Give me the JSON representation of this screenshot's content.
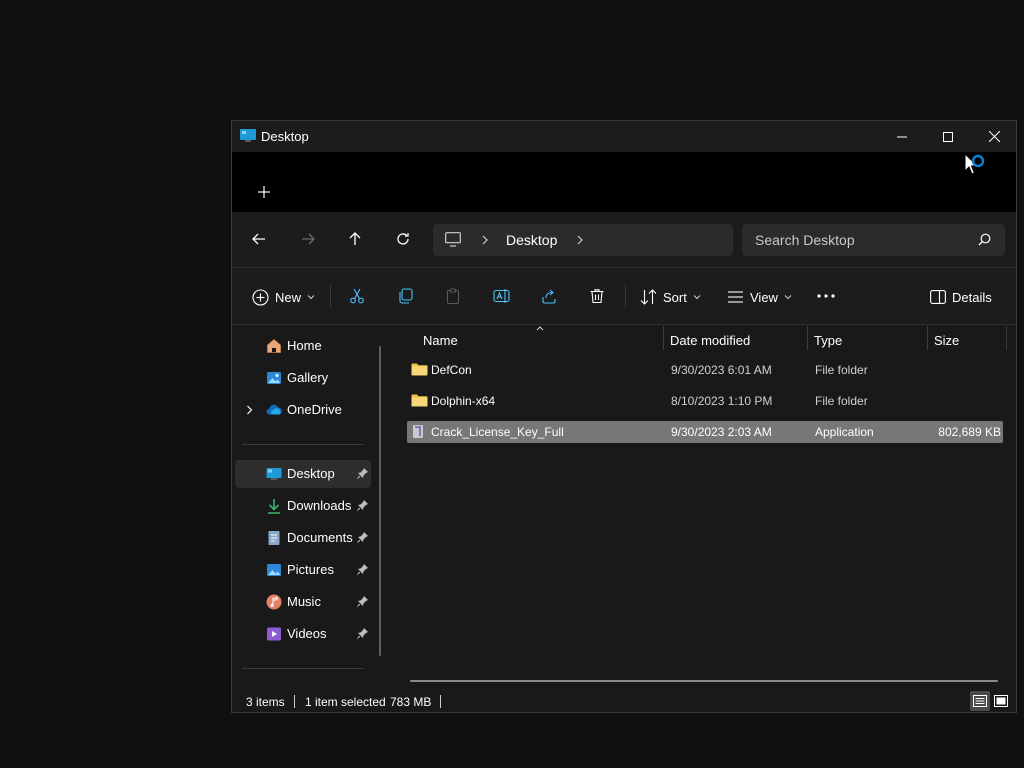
{
  "window": {
    "title": "Desktop"
  },
  "navbar": {
    "address_segment": "Desktop",
    "search_placeholder": "Search Desktop"
  },
  "commands": {
    "new_label": "New",
    "sort_label": "Sort",
    "view_label": "View",
    "details_label": "Details"
  },
  "sidebar": {
    "items": [
      {
        "label": "Home",
        "icon": "home-icon"
      },
      {
        "label": "Gallery",
        "icon": "gallery-icon"
      },
      {
        "label": "OneDrive",
        "icon": "onedrive-icon"
      },
      {
        "label": "Desktop",
        "icon": "desktop-icon",
        "pinned": true,
        "active": true
      },
      {
        "label": "Downloads",
        "icon": "download-icon",
        "pinned": true
      },
      {
        "label": "Documents",
        "icon": "document-icon",
        "pinned": true
      },
      {
        "label": "Pictures",
        "icon": "pictures-icon",
        "pinned": true
      },
      {
        "label": "Music",
        "icon": "music-icon",
        "pinned": true
      },
      {
        "label": "Videos",
        "icon": "videos-icon",
        "pinned": true
      }
    ]
  },
  "columns": [
    "Name",
    "Date modified",
    "Type",
    "Size"
  ],
  "files": [
    {
      "name": "DefCon",
      "date": "9/30/2023 6:01 AM",
      "type": "File folder",
      "size": ""
    },
    {
      "name": "Dolphin-x64",
      "date": "8/10/2023 1:10 PM",
      "type": "File folder",
      "size": ""
    },
    {
      "name": "Crack_License_Key_Full",
      "date": "9/30/2023 2:03 AM",
      "type": "Application",
      "size": "802,689 KB",
      "selected": true
    }
  ],
  "status": {
    "count": "3 items",
    "selection": "1 item selected",
    "selection_size": "783 MB"
  },
  "colors": {
    "accent": "#0078d4",
    "folder": "#f4c247",
    "selection": "#777777"
  }
}
